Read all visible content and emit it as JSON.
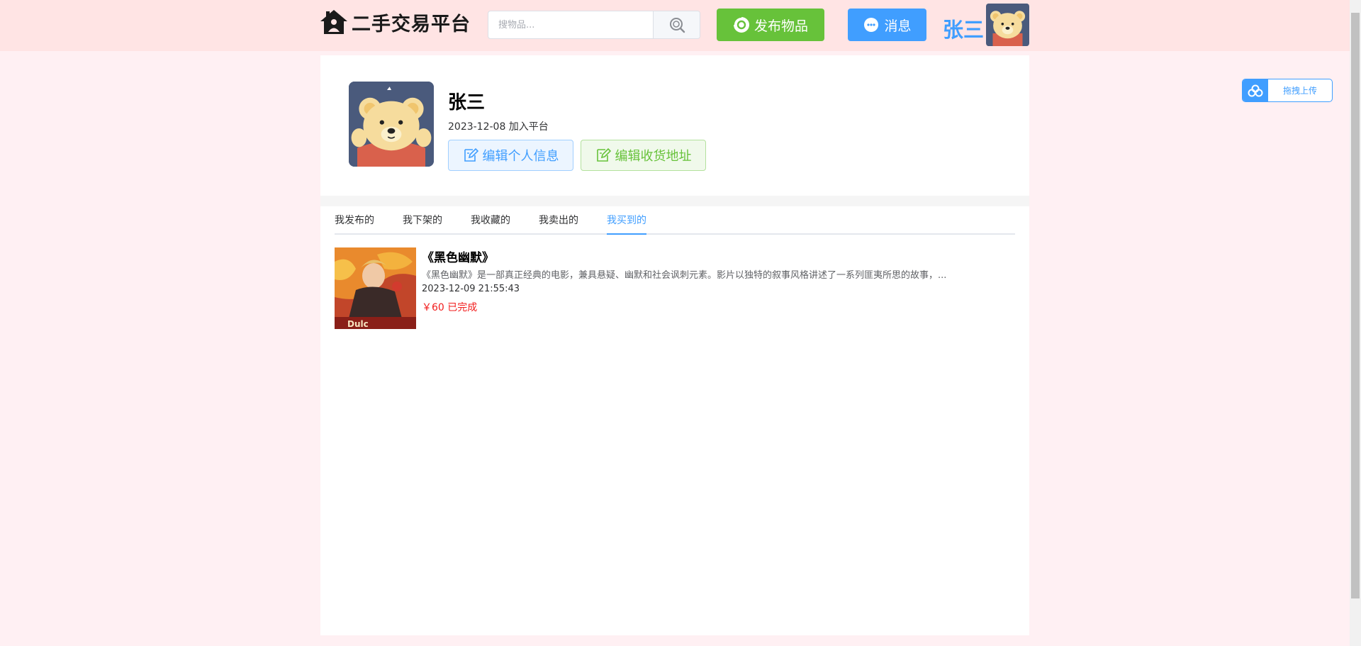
{
  "header": {
    "logo_text": "二手交易平台",
    "search_placeholder": "搜物品...",
    "publish_label": "发布物品",
    "message_label": "消息",
    "username": "张三"
  },
  "float_upload": {
    "label": "拖拽上传"
  },
  "profile": {
    "name": "张三",
    "joined": "2023-12-08 加入平台",
    "edit_info_label": "编辑个人信息",
    "edit_address_label": "编辑收货地址"
  },
  "tabs": [
    {
      "label": "我发布的"
    },
    {
      "label": "我下架的"
    },
    {
      "label": "我收藏的"
    },
    {
      "label": "我卖出的"
    },
    {
      "label": "我买到的"
    }
  ],
  "active_tab": "我买到的",
  "items": [
    {
      "title": "《黑色幽默》",
      "description": "《黑色幽默》是一部真正经典的电影，兼具悬疑、幽默和社会讽刺元素。影片以独特的叙事风格讲述了一系列匪夷所思的故事，...",
      "time": "2023-12-09 21:55:43",
      "price_status": "￥60 已完成"
    }
  ],
  "colors": {
    "primary": "#409eff",
    "success": "#67c23a",
    "price": "#f21d1d",
    "header_bg": "#ffe4e4",
    "page_bg": "#fff0f3"
  }
}
